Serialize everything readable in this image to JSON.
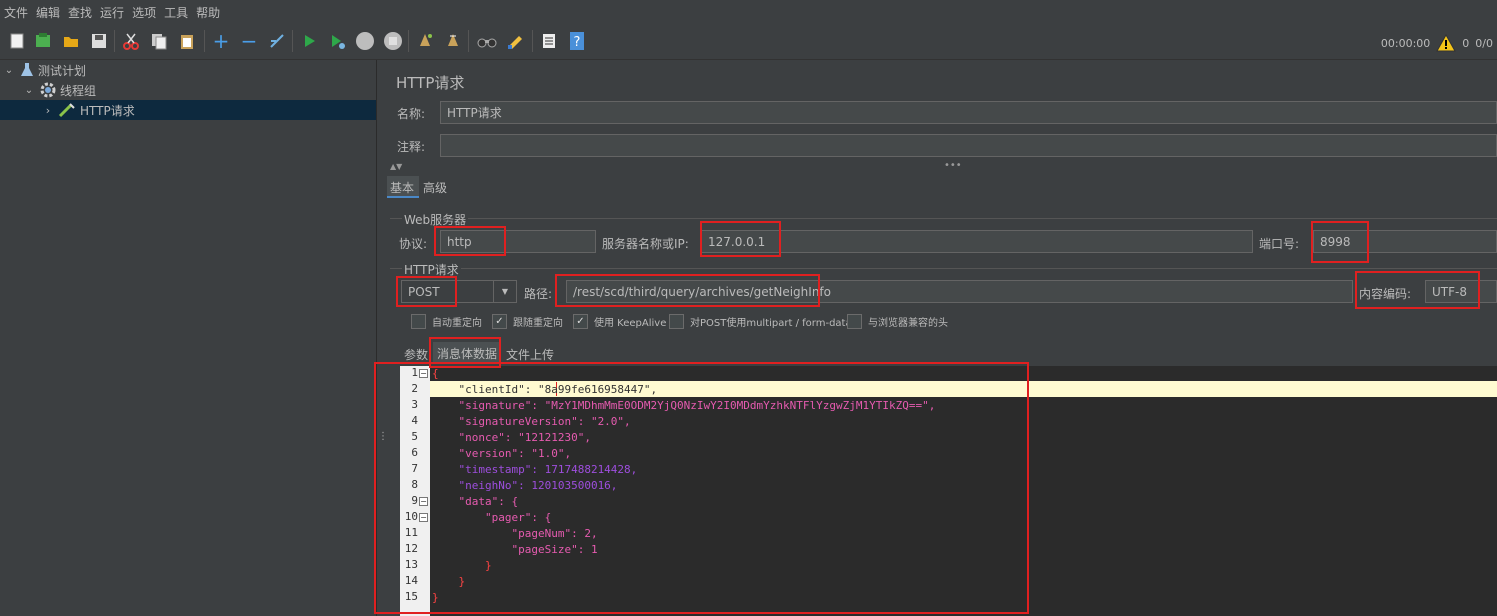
{
  "menu": [
    "文件",
    "编辑",
    "查找",
    "运行",
    "选项",
    "工具",
    "帮助"
  ],
  "status": {
    "elapsed": "00:00:00",
    "warnings": "0",
    "threads": "0/0"
  },
  "tree": {
    "items": [
      "测试计划",
      "线程组",
      "HTTP请求"
    ]
  },
  "panel": {
    "title": "HTTP请求",
    "name_label": "名称:",
    "name_value": "HTTP请求",
    "comment_label": "注释:",
    "comment_value": "",
    "tabs": [
      "基本",
      "高级"
    ],
    "web_server_section": "Web服务器",
    "protocol_label": "协议:",
    "protocol_value": "http",
    "server_label": "服务器名称或IP:",
    "server_value": "127.0.0.1",
    "port_label": "端口号:",
    "port_value": "8998",
    "http_request_section": "HTTP请求",
    "method_value": "POST",
    "path_label": "路径:",
    "path_value": "/rest/scd/third/query/archives/getNeighInfo",
    "encoding_label": "内容编码:",
    "encoding_value": "UTF-8",
    "options": [
      {
        "label": "自动重定向",
        "checked": false
      },
      {
        "label": "跟随重定向",
        "checked": true
      },
      {
        "label": "使用 KeepAlive",
        "checked": true
      },
      {
        "label": "对POST使用multipart / form-data",
        "checked": false
      },
      {
        "label": "与浏览器兼容的头",
        "checked": false
      }
    ],
    "body_tabs": [
      "参数",
      "消息体数据",
      "文件上传"
    ]
  },
  "editor": {
    "line_numbers": [
      "1",
      "2",
      "3",
      "4",
      "5",
      "6",
      "7",
      "8",
      "9",
      "10",
      "11",
      "12",
      "13",
      "14",
      "15"
    ],
    "lines": [
      "{",
      "    \"clientId\": \"8a99fe616958447\",",
      "    \"signature\": \"MzY1MDhmMmE0ODM2YjQ0NzIwY2I0MDdmYzhkNTFlYzgwZjM1YTIkZQ==\",",
      "    \"signatureVersion\": \"2.0\",",
      "    \"nonce\": \"12121230\",",
      "    \"version\": \"1.0\",",
      "    \"timestamp\": 1717488214428,",
      "    \"neighNo\": 120103500016,",
      "    \"data\": {",
      "        \"pager\": {",
      "            \"pageNum\": 2,",
      "            \"pageSize\": 1",
      "        }",
      "    }",
      "}"
    ]
  }
}
